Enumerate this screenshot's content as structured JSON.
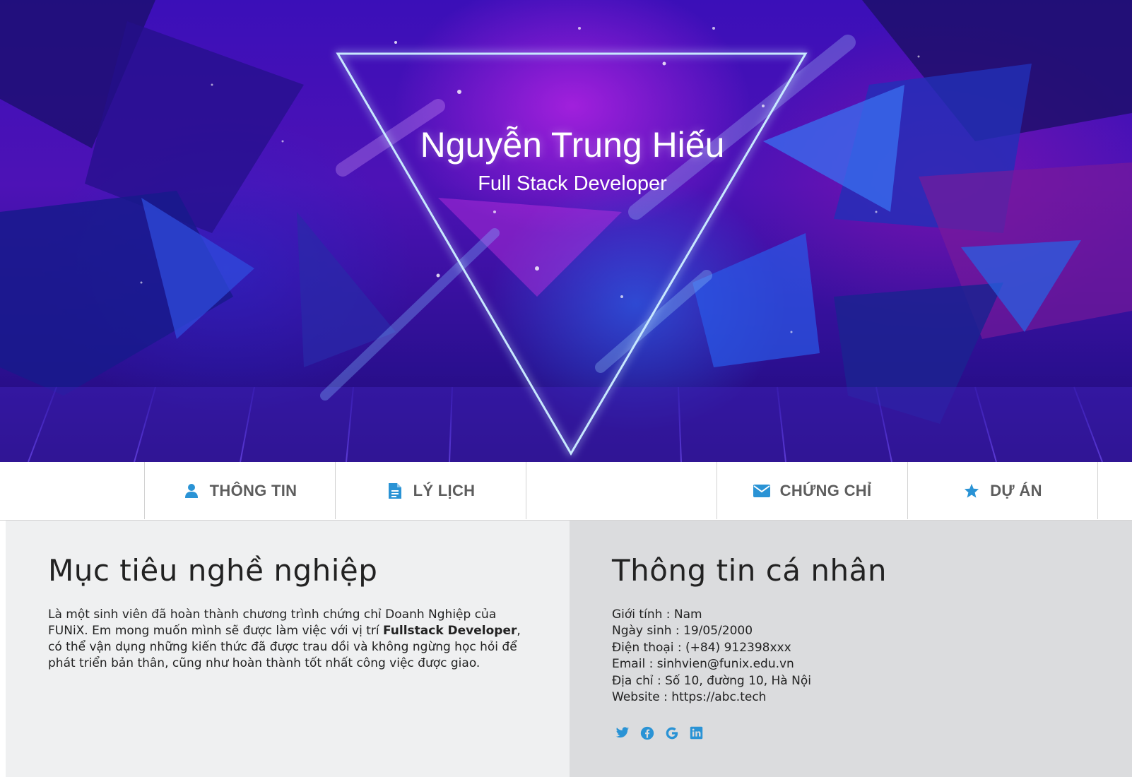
{
  "hero": {
    "name": "Nguyễn Trung Hiếu",
    "role": "Full Stack Developer"
  },
  "nav": {
    "items": [
      {
        "label": "THÔNG TIN",
        "icon": "user-icon"
      },
      {
        "label": "LÝ LỊCH",
        "icon": "document-icon"
      },
      {
        "label": "",
        "icon": ""
      },
      {
        "label": "CHỨNG CHỈ",
        "icon": "envelope-icon"
      },
      {
        "label": "DỰ ÁN",
        "icon": "star-icon"
      }
    ]
  },
  "objective": {
    "title": "Mục tiêu nghề nghiệp",
    "text_before": "Là một sinh viên đã hoàn thành chương trình chứng chỉ Doanh Nghiệp của FUNiX. Em mong muốn mình sẽ được làm việc với vị trí ",
    "highlight": "Fullstack Developer",
    "text_after": ", có thể vận dụng những kiến thức đã được trau dồi và không ngừng học hỏi để phát triển bản thân, cũng như hoàn thành tốt nhất công việc được giao."
  },
  "personal": {
    "title": "Thông tin cá nhân",
    "gender": "Giới tính : Nam",
    "birthday": "Ngày sinh : 19/05/2000",
    "phone": "Điện thoại : (+84) 912398xxx",
    "email": "Email : sinhvien@funix.edu.vn",
    "address": "Địa chỉ : Số 10, đường 10, Hà Nội",
    "website": "Website : https://abc.tech"
  },
  "socials": [
    "twitter-icon",
    "facebook-icon",
    "google-icon",
    "linkedin-icon"
  ],
  "colors": {
    "accent": "#2a93d5",
    "nav_text": "#5d5d5d",
    "panel_left": "#eff0f1",
    "panel_right": "#dbdcde"
  }
}
